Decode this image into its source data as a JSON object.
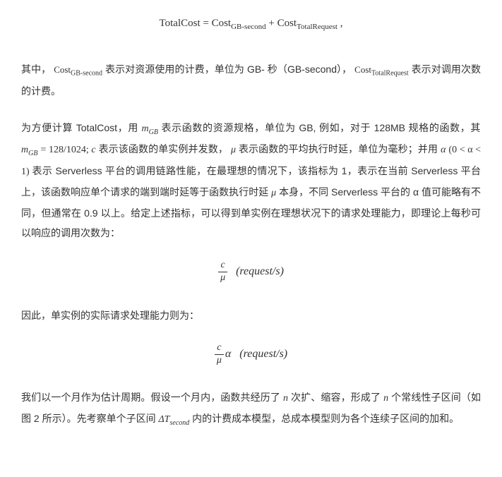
{
  "eq_top": {
    "lhs": "TotalCost",
    "eq": "=",
    "t1_base": "Cost",
    "t1_sub": "GB-second",
    "plus": "+",
    "t2_base": "Cost",
    "t2_sub": "TotalRequest",
    "tail": ","
  },
  "p1": {
    "a": "其中，",
    "cost_gb_base": "Cost",
    "cost_gb_sub": "GB-second",
    "b": " 表示对资源使用的计费，单位为 GB- 秒（GB-second），",
    "cost_tr_base": "Cost",
    "cost_tr_sub": "TotalRequest",
    "c": " 表示对调用次数的计费。"
  },
  "p2": {
    "a": "为方便计算 TotalCost，用 ",
    "m_gb": "m",
    "m_gb_sub": "GB",
    "b": " 表示函数的资源规格，单位为 GB, 例如，对于 128MB 规格的函数，其 ",
    "m_gb2": "m",
    "m_gb2_sub": "GB",
    "eqv": " = 128/1024; ",
    "c_var": "c",
    "c": " 表示该函数的单实例并发数，",
    "mu": "μ",
    "d": " 表示函数的平均执行时延，单位为毫秒；并用 ",
    "alpha": "α",
    "alpha_range": " (0 < α < 1) ",
    "e": "表示 Serverless 平台的调用链路性能，在最理想的情况下，该指标为 1，表示在当前 Serverless 平台上，该函数响应单个请求的端到端时延等于函数执行时延 ",
    "mu2": "μ",
    "f": " 本身，不同 Serverless 平台的 α 值可能略有不同，但通常在 0.9 以上。给定上述指标，可以得到单实例在理想状况下的请求处理能力，即理论上每秒可以响应的调用次数为："
  },
  "eq_mid": {
    "num": "c",
    "den": "μ",
    "unit": "(request/s)"
  },
  "p3": {
    "a": "因此，单实例的实际请求处理能力则为："
  },
  "eq_mid2": {
    "num": "c",
    "den": "μ",
    "alpha": "α",
    "unit": "(request/s)"
  },
  "p4": {
    "a": "我们以一个月作为估计周期。假设一个月内，函数共经历了 ",
    "n1": "n",
    "b": " 次扩、缩容，形成了 ",
    "n2": "n",
    "c": " 个常线性子区间（如图 2 所示）。先考察单个子区间 ",
    "dT": "ΔT",
    "dT_sub": "second",
    "d": " 内的计费成本模型，总成本模型则为各个连续子区间的加和。"
  }
}
